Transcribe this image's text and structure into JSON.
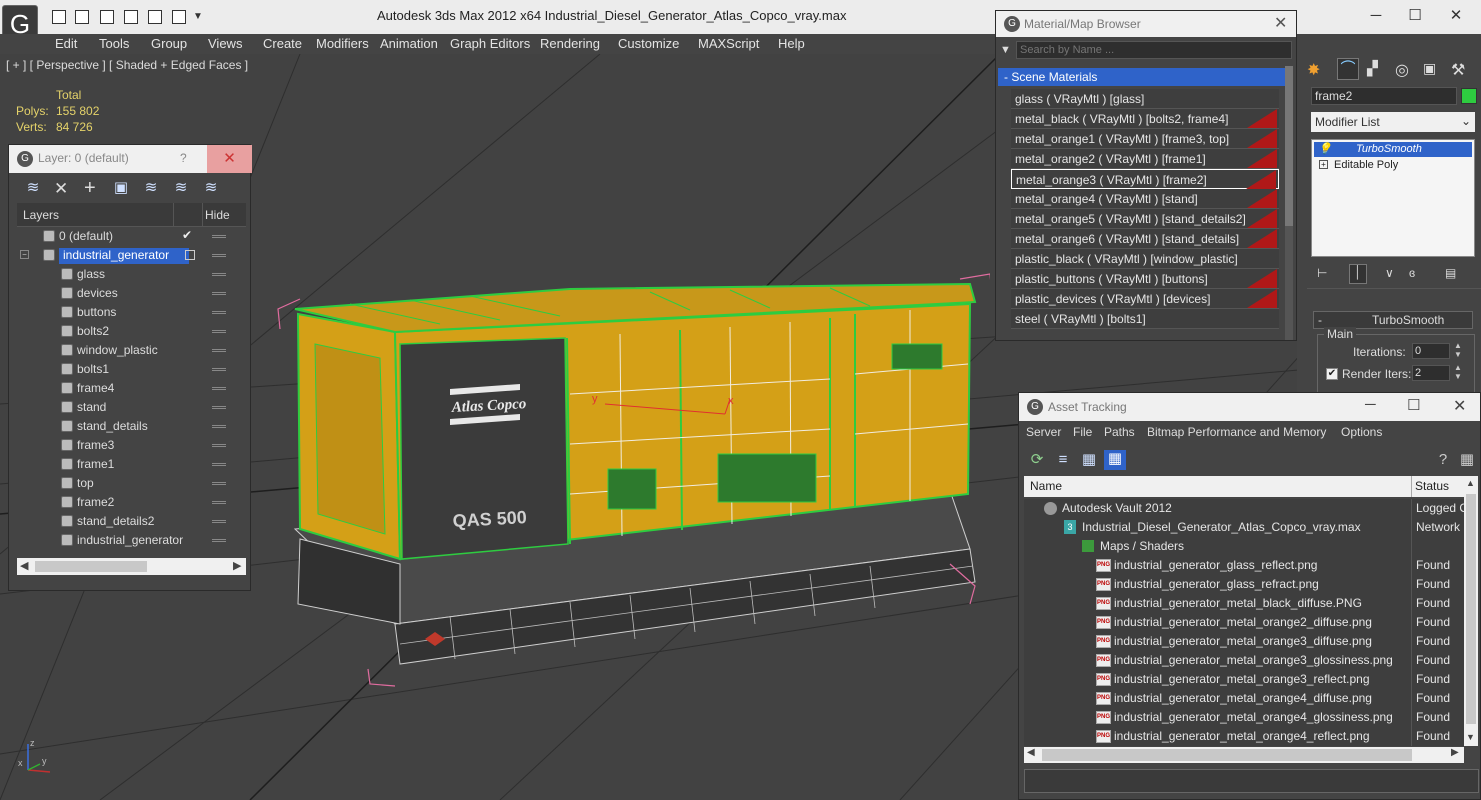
{
  "app": {
    "title": "Autodesk 3ds Max  2012 x64      Industrial_Diesel_Generator_Atlas_Copco_vray.max",
    "logo_icon": "3dsmax-logo-icon"
  },
  "menu": [
    "Edit",
    "Tools",
    "Group",
    "Views",
    "Create",
    "Modifiers",
    "Animation",
    "Graph Editors",
    "Rendering",
    "Customize",
    "MAXScript",
    "Help"
  ],
  "viewport": {
    "label": "[ + ] [ Perspective ] [ Shaded + Edged Faces ]",
    "stats": {
      "total": "Total",
      "polys_label": "Polys:",
      "polys": "155 802",
      "verts_label": "Verts:",
      "verts": "84 726"
    },
    "model_brand": "Atlas Copco",
    "model_name": "QAS 500",
    "gizmo_x": "x",
    "gizmo_y": "y",
    "axis_x": "x",
    "axis_y": "y",
    "axis_z": "z"
  },
  "layer_panel": {
    "title": "Layer: 0 (default)",
    "help": "?",
    "close": "✕",
    "col_layers": "Layers",
    "col_hide": "Hide",
    "rows": [
      {
        "name": "0 (default)",
        "level": 0,
        "checked": true
      },
      {
        "name": "industrial_generator",
        "level": 0,
        "selected": true
      },
      {
        "name": "glass",
        "level": 1
      },
      {
        "name": "devices",
        "level": 1
      },
      {
        "name": "buttons",
        "level": 1
      },
      {
        "name": "bolts2",
        "level": 1
      },
      {
        "name": "window_plastic",
        "level": 1
      },
      {
        "name": "bolts1",
        "level": 1
      },
      {
        "name": "frame4",
        "level": 1
      },
      {
        "name": "stand",
        "level": 1
      },
      {
        "name": "stand_details",
        "level": 1
      },
      {
        "name": "frame3",
        "level": 1
      },
      {
        "name": "frame1",
        "level": 1
      },
      {
        "name": "top",
        "level": 1
      },
      {
        "name": "frame2",
        "level": 1
      },
      {
        "name": "stand_details2",
        "level": 1
      },
      {
        "name": "industrial_generator",
        "level": 1
      }
    ]
  },
  "material_browser": {
    "title": "Material/Map Browser",
    "search_placeholder": "Search by Name ...",
    "group": "- Scene Materials",
    "items": [
      {
        "label": "glass  ( VRayMtl ) [glass]",
        "swatch": false
      },
      {
        "label": "metal_black  ( VRayMtl ) [bolts2, frame4]",
        "swatch": true
      },
      {
        "label": "metal_orange1  ( VRayMtl ) [frame3, top]",
        "swatch": true
      },
      {
        "label": "metal_orange2  ( VRayMtl ) [frame1]",
        "swatch": true
      },
      {
        "label": "metal_orange3  ( VRayMtl ) [frame2]",
        "swatch": true,
        "selected": true
      },
      {
        "label": "metal_orange4  ( VRayMtl ) [stand]",
        "swatch": true
      },
      {
        "label": "metal_orange5  ( VRayMtl ) [stand_details2]",
        "swatch": true
      },
      {
        "label": "metal_orange6  ( VRayMtl ) [stand_details]",
        "swatch": true
      },
      {
        "label": "plastic_black  ( VRayMtl ) [window_plastic]",
        "swatch": false
      },
      {
        "label": "plastic_buttons  ( VRayMtl ) [buttons]",
        "swatch": true
      },
      {
        "label": "plastic_devices  ( VRayMtl ) [devices]",
        "swatch": true
      },
      {
        "label": "steel  ( VRayMtl ) [bolts1]",
        "swatch": false
      }
    ]
  },
  "command_panel": {
    "object_name": "frame2",
    "modifier_list": "Modifier List",
    "stack": [
      "TurboSmooth",
      "Editable Poly"
    ],
    "rollout_title": "TurboSmooth",
    "group_main": "Main",
    "iterations_label": "Iterations:",
    "iterations_value": "0",
    "render_iters_label": "Render Iters:",
    "render_iters_value": "2",
    "render_iters_checked": true,
    "collapse": "-"
  },
  "asset_tracking": {
    "title": "Asset Tracking",
    "menu": [
      "Server",
      "File",
      "Paths",
      "Bitmap Performance and Memory",
      "Options"
    ],
    "col_name": "Name",
    "col_status": "Status",
    "rows": [
      {
        "name": "Autodesk Vault 2012",
        "status": "Logged O",
        "indent": 20,
        "icon": "vault"
      },
      {
        "name": "Industrial_Diesel_Generator_Atlas_Copco_vray.max",
        "status": "Network",
        "indent": 40,
        "icon": "max"
      },
      {
        "name": "Maps / Shaders",
        "status": "",
        "indent": 58,
        "icon": "maps"
      },
      {
        "name": "industrial_generator_glass_reflect.png",
        "status": "Found",
        "indent": 72,
        "icon": "png"
      },
      {
        "name": "industrial_generator_glass_refract.png",
        "status": "Found",
        "indent": 72,
        "icon": "png"
      },
      {
        "name": "industrial_generator_metal_black_diffuse.PNG",
        "status": "Found",
        "indent": 72,
        "icon": "png"
      },
      {
        "name": "industrial_generator_metal_orange2_diffuse.png",
        "status": "Found",
        "indent": 72,
        "icon": "png"
      },
      {
        "name": "industrial_generator_metal_orange3_diffuse.png",
        "status": "Found",
        "indent": 72,
        "icon": "png"
      },
      {
        "name": "industrial_generator_metal_orange3_glossiness.png",
        "status": "Found",
        "indent": 72,
        "icon": "png"
      },
      {
        "name": "industrial_generator_metal_orange3_reflect.png",
        "status": "Found",
        "indent": 72,
        "icon": "png"
      },
      {
        "name": "industrial_generator_metal_orange4_diffuse.png",
        "status": "Found",
        "indent": 72,
        "icon": "png"
      },
      {
        "name": "industrial_generator_metal_orange4_glossiness.png",
        "status": "Found",
        "indent": 72,
        "icon": "png"
      },
      {
        "name": "industrial_generator_metal_orange4_reflect.png",
        "status": "Found",
        "indent": 72,
        "icon": "png"
      }
    ],
    "png_badge": "PNG"
  },
  "colors": {
    "accent_select": "#2f63c9",
    "material_swatch": "#b01818",
    "model_orange": "#d4a017",
    "wire_green": "#2ecc40"
  }
}
